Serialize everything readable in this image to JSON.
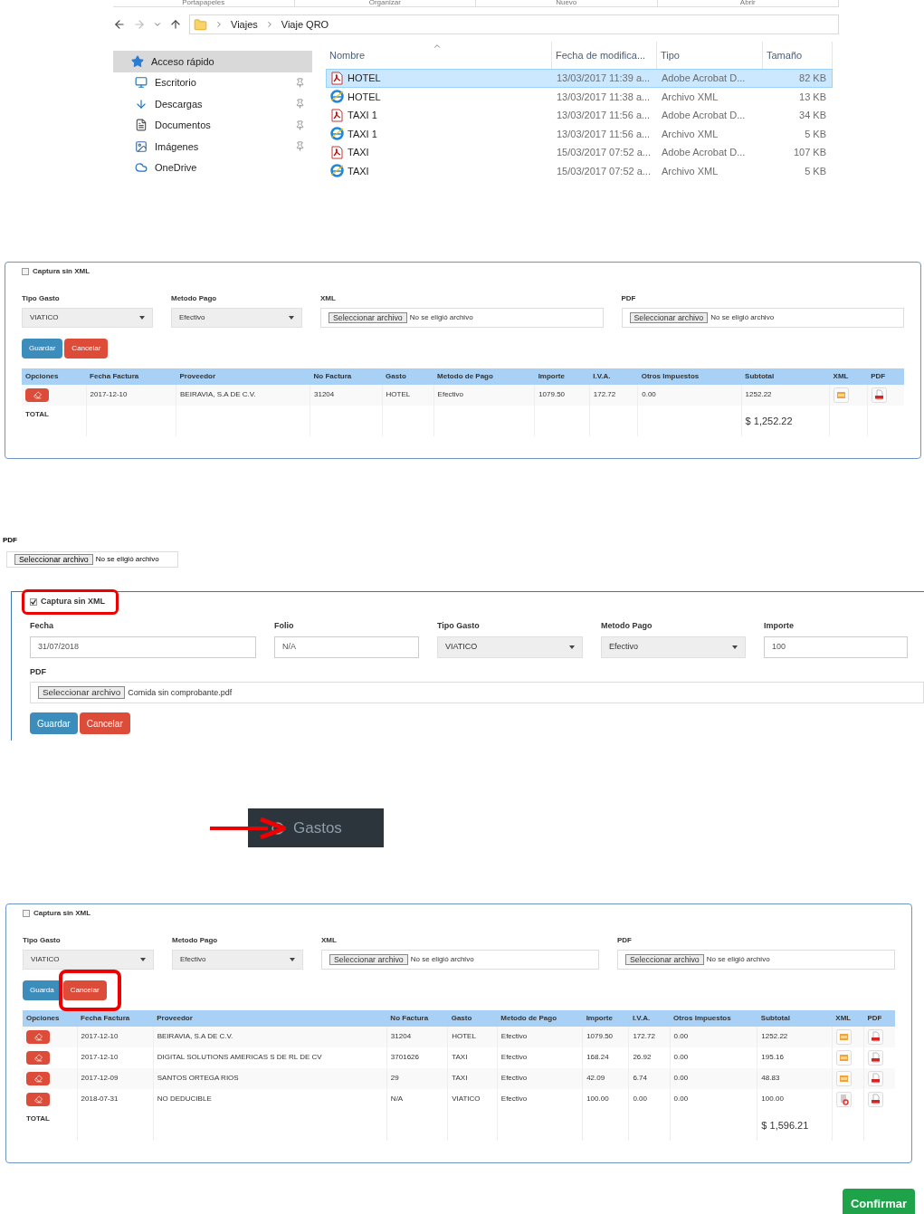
{
  "explorer": {
    "ribbon_groups": [
      "Portapapeles",
      "Organizar",
      "Nuevo",
      "Abrir"
    ],
    "breadcrumb": [
      "Viajes",
      "Viaje QRO"
    ],
    "nav_items": [
      {
        "label": "Acceso rápido",
        "kind": "star",
        "pinned": false,
        "selected": true
      },
      {
        "label": "Escritorio",
        "kind": "desktop",
        "pinned": true,
        "selected": false
      },
      {
        "label": "Descargas",
        "kind": "download",
        "pinned": true,
        "selected": false
      },
      {
        "label": "Documentos",
        "kind": "document",
        "pinned": true,
        "selected": false
      },
      {
        "label": "Imágenes",
        "kind": "image",
        "pinned": true,
        "selected": false
      },
      {
        "label": "OneDrive",
        "kind": "cloud",
        "pinned": false,
        "selected": false
      }
    ],
    "columns": [
      "Nombre",
      "Fecha de modifica...",
      "Tipo",
      "Tamaño"
    ],
    "files": [
      {
        "name": "HOTEL",
        "kind": "pdf",
        "modified": "13/03/2017 11:39 a...",
        "type": "Adobe Acrobat D...",
        "size": "82 KB",
        "selected": true
      },
      {
        "name": "HOTEL",
        "kind": "xml",
        "modified": "13/03/2017 11:38 a...",
        "type": "Archivo XML",
        "size": "13 KB",
        "selected": false
      },
      {
        "name": "TAXI 1",
        "kind": "pdf",
        "modified": "13/03/2017 11:56 a...",
        "type": "Adobe Acrobat D...",
        "size": "34 KB",
        "selected": false
      },
      {
        "name": "TAXI 1",
        "kind": "xml",
        "modified": "13/03/2017 11:56 a...",
        "type": "Archivo XML",
        "size": "5 KB",
        "selected": false
      },
      {
        "name": "TAXI",
        "kind": "pdf",
        "modified": "15/03/2017 07:52 a...",
        "type": "Adobe Acrobat D...",
        "size": "107 KB",
        "selected": false
      },
      {
        "name": "TAXI",
        "kind": "xml",
        "modified": "15/03/2017 07:52 a...",
        "type": "Archivo XML",
        "size": "5 KB",
        "selected": false
      }
    ]
  },
  "expense_form": {
    "capture_without_xml": {
      "label": "Captura sin XML",
      "checked": false,
      "highlighted": false
    },
    "fields": [
      {
        "label": "Tipo Gasto",
        "kind": "select",
        "value": "VIATICO"
      },
      {
        "label": "Metodo Pago",
        "kind": "select",
        "value": "Efectivo"
      },
      {
        "label": "XML",
        "kind": "file",
        "button": "Seleccionar archivo",
        "value": "No se eligió archivo"
      },
      {
        "label": "PDF",
        "kind": "file",
        "button": "Seleccionar archivo",
        "value": "No se eligió archivo"
      }
    ],
    "buttons": [
      {
        "label": "Guardar",
        "kind": "primary",
        "highlighted": false
      },
      {
        "label": "Cancelar",
        "kind": "danger",
        "highlighted": false
      }
    ],
    "table": {
      "columns": [
        "Opciones",
        "Fecha Factura",
        "Proveedor",
        "No Factura",
        "Gasto",
        "Metodo de Pago",
        "Importe",
        "I.V.A.",
        "Otros Impuestos",
        "Subtotal",
        "XML",
        "PDF"
      ],
      "rows": [
        {
          "cells": [
            "",
            "2017-12-10",
            "BEIRAVIA, S.A DE C.V.",
            "31204",
            "HOTEL",
            "Efectivo",
            "1079.50",
            "172.72",
            "0.00",
            "1252.22"
          ],
          "kind": "xml"
        }
      ],
      "total_label": "TOTAL",
      "total": "$ 1,252.22"
    }
  },
  "pdf_upload": {
    "label": "PDF",
    "button": "Seleccionar archivo",
    "value": "No se eligió archivo"
  },
  "manual_form": {
    "capture_without_xml": {
      "label": "Captura sin XML",
      "checked": true,
      "highlighted": true
    },
    "fields": [
      {
        "label": "Fecha",
        "kind": "text",
        "value": "31/07/2018"
      },
      {
        "label": "Folio",
        "kind": "text",
        "value": "N/A"
      },
      {
        "label": "Tipo Gasto",
        "kind": "select",
        "value": "VIATICO"
      },
      {
        "label": "Metodo Pago",
        "kind": "select",
        "value": "Efectivo"
      },
      {
        "label": "Importe",
        "kind": "text",
        "value": "100"
      }
    ],
    "pdf": {
      "label": "PDF",
      "button": "Seleccionar archivo",
      "value": "Comida sin comprobante.pdf"
    },
    "buttons": [
      {
        "label": "Guardar",
        "kind": "primary",
        "highlighted": false
      },
      {
        "label": "Cancelar",
        "kind": "danger",
        "highlighted": false
      }
    ]
  },
  "menu_item": {
    "label": "Gastos"
  },
  "expense_form_result": {
    "capture_without_xml": {
      "label": "Captura sin XML",
      "checked": false,
      "highlighted": false
    },
    "fields": [
      {
        "label": "Tipo Gasto",
        "kind": "select",
        "value": "VIATICO"
      },
      {
        "label": "Metodo Pago",
        "kind": "select",
        "value": "Efectivo"
      },
      {
        "label": "XML",
        "kind": "file",
        "button": "Seleccionar archivo",
        "value": "No se eligió archivo"
      },
      {
        "label": "PDF",
        "kind": "file",
        "button": "Seleccionar archivo",
        "value": "No se eligió archivo"
      }
    ],
    "buttons": [
      {
        "label": "Guarda",
        "kind": "primary",
        "highlighted": false
      },
      {
        "label": "Cancelar",
        "kind": "danger",
        "highlighted": true
      }
    ],
    "table": {
      "columns": [
        "Opciones",
        "Fecha Factura",
        "Proveedor",
        "No Factura",
        "Gasto",
        "Metodo de Pago",
        "Importe",
        "I.V.A.",
        "Otros Impuestos",
        "Subtotal",
        "XML",
        "PDF"
      ],
      "rows": [
        {
          "cells": [
            "",
            "2017-12-10",
            "BEIRAVIA, S.A DE C.V.",
            "31204",
            "HOTEL",
            "Efectivo",
            "1079.50",
            "172.72",
            "0.00",
            "1252.22"
          ],
          "kind": "xml"
        },
        {
          "cells": [
            "",
            "2017-12-10",
            "DIGITAL SOLUTIONS AMERICAS S DE RL DE CV",
            "3701626",
            "TAXI",
            "Efectivo",
            "168.24",
            "26.92",
            "0.00",
            "195.16"
          ],
          "kind": "xml"
        },
        {
          "cells": [
            "",
            "2017-12-09",
            "SANTOS ORTEGA RIOS",
            "29",
            "TAXI",
            "Efectivo",
            "42.09",
            "6.74",
            "0.00",
            "48.83"
          ],
          "kind": "xml"
        },
        {
          "cells": [
            "",
            "2018-07-31",
            "NO DEDUCIBLE",
            "N/A",
            "VIATICO",
            "Efectivo",
            "100.00",
            "0.00",
            "0.00",
            "100.00"
          ],
          "kind": "missing"
        }
      ],
      "total_label": "TOTAL",
      "total": "$ 1,596.21"
    }
  },
  "confirm_button": {
    "label": "Confirmar"
  }
}
